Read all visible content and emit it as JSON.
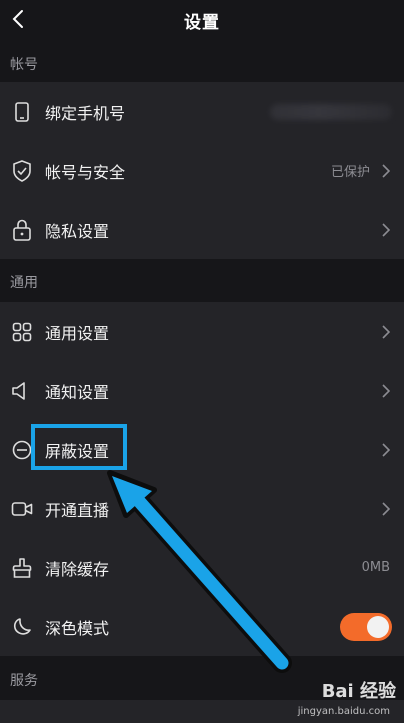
{
  "header": {
    "title": "设置"
  },
  "sections": {
    "account": {
      "label": "帐号",
      "items": [
        {
          "label": "绑定手机号",
          "icon": "phone-icon"
        },
        {
          "label": "帐号与安全",
          "value": "已保护",
          "icon": "shield-check-icon"
        },
        {
          "label": "隐私设置",
          "icon": "lock-icon"
        }
      ]
    },
    "general": {
      "label": "通用",
      "items": [
        {
          "label": "通用设置",
          "icon": "grid-icon"
        },
        {
          "label": "通知设置",
          "icon": "speaker-icon"
        },
        {
          "label": "屏蔽设置",
          "icon": "block-icon"
        },
        {
          "label": "开通直播",
          "icon": "video-camera-icon"
        },
        {
          "label": "清除缓存",
          "value": "0MB",
          "icon": "broom-icon"
        },
        {
          "label": "深色模式",
          "icon": "moon-icon",
          "toggle_on": true
        }
      ]
    },
    "services": {
      "label": "服务"
    }
  },
  "colors": {
    "background": "#161619",
    "row": "#242428",
    "accent_toggle": "#f36b2a",
    "annotation": "#1aa3e8"
  },
  "watermark": {
    "text": "Bai 经验",
    "url": "jingyan.baidu.com"
  }
}
